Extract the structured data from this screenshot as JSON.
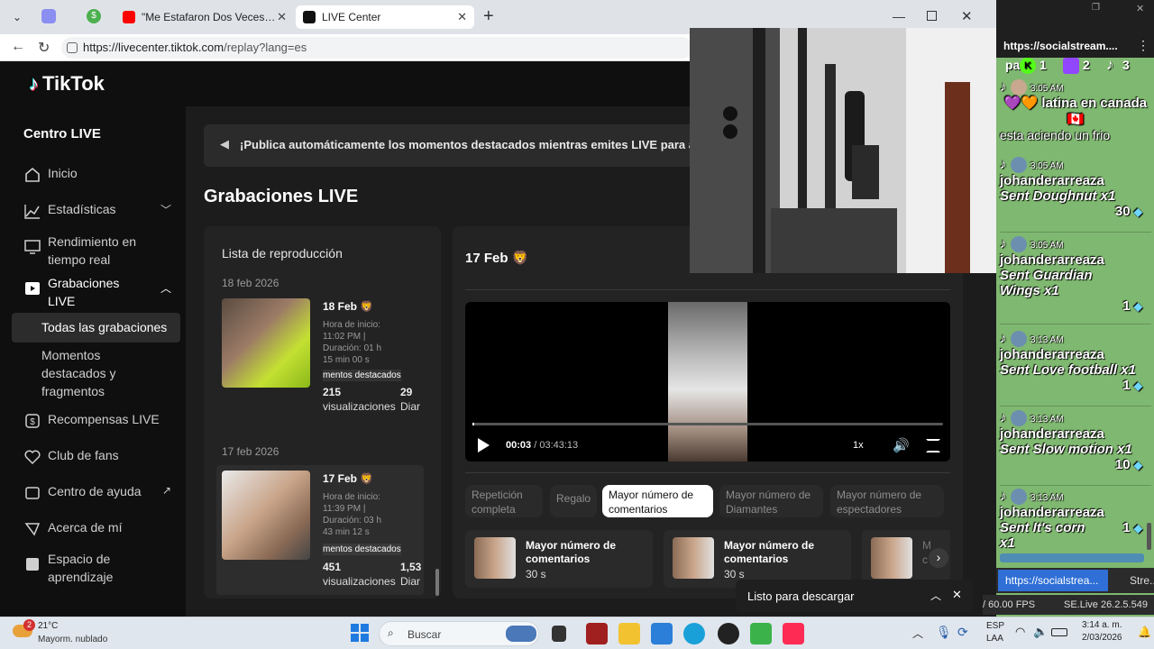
{
  "browser": {
    "tabs": [
      {
        "label": "\"Me Estafaron Dos Veces y hoy Te"
      },
      {
        "label": "LIVE Center"
      }
    ],
    "url_host": "https://livecenter.tiktok.com",
    "url_path": "/replay?lang=es"
  },
  "sidebar": {
    "logo": "TikTok",
    "title": "Centro LIVE",
    "items": [
      {
        "label": "Inicio"
      },
      {
        "label": "Estadísticas"
      },
      {
        "label": "Rendimiento en tiempo real"
      },
      {
        "label": "Grabaciones LIVE"
      },
      {
        "label": "Todas las grabaciones"
      },
      {
        "label": "Momentos destacados y fragmentos"
      },
      {
        "label": "Recompensas LIVE"
      },
      {
        "label": "Club de fans"
      },
      {
        "label": "Centro de ayuda"
      },
      {
        "label": "Acerca de mí"
      },
      {
        "label": "Espacio de aprendizaje"
      }
    ]
  },
  "main": {
    "banner": "¡Publica automáticamente los momentos destacados mientras emites LIVE para atr",
    "title": "Grabaciones LIVE",
    "playlist": {
      "title": "Lista de reproducción",
      "groups": [
        {
          "date": "18 feb 2026",
          "item": {
            "title": "18 Feb 🦁",
            "start_label": "Hora de inicio:",
            "start": "11:02 PM |",
            "duration_label": "Duración: 01 h",
            "duration": "15 min 00 s",
            "highlights": "mentos destacados",
            "views": "215",
            "views_label": "visualizaciones",
            "diamonds": "29",
            "diamonds_label": "Diar"
          }
        },
        {
          "date": "17 feb 2026",
          "item": {
            "title": "17 Feb 🦁",
            "start_label": "Hora de inicio:",
            "start": "11:39 PM |",
            "duration_label": "Duración: 03 h",
            "duration": "43 min 12 s",
            "highlights": "mentos destacados",
            "views": "451",
            "views_label": "visualizaciones",
            "diamonds": "1,53",
            "diamonds_label": "Diar"
          }
        }
      ]
    },
    "player": {
      "title": "17 Feb 🦁",
      "current_time": "00:03",
      "total_time": "03:43:13",
      "speed": "1x",
      "progress": 0.0002
    },
    "filters": [
      {
        "label": "Repetición completa"
      },
      {
        "label": "Regalo"
      },
      {
        "label": "Mayor número de comentarios"
      },
      {
        "label": "Mayor número de Diamantes"
      },
      {
        "label": "Mayor número de espectadores"
      }
    ],
    "highlights": [
      {
        "title": "Mayor número de comentarios",
        "duration": "30 s"
      },
      {
        "title": "Mayor número de comentarios",
        "duration": "30 s"
      },
      {
        "title": "M",
        "duration": "c"
      }
    ]
  },
  "toast": {
    "label": "Listo para descargar"
  },
  "chat": {
    "url": "https://socialstream....",
    "header_counts": [
      "1",
      "2",
      "3"
    ],
    "header_text": "pa",
    "messages": [
      {
        "time": "3:05 AM",
        "name": "💜🧡 latina en canada🇨🇦",
        "text": "esta aciendo un frio",
        "amount": ""
      },
      {
        "time": "3:05 AM",
        "name": "johanderarreaza",
        "text": "Sent Doughnut x1",
        "amount": "30"
      },
      {
        "time": "3:05 AM",
        "name": "johanderarreaza",
        "text": "Sent Guardian Wings x1",
        "amount": "1"
      },
      {
        "time": "3:13 AM",
        "name": "johanderarreaza",
        "text": "Sent Love football x1",
        "amount": "1"
      },
      {
        "time": "3:13 AM",
        "name": "johanderarreaza",
        "text": "Sent Slow motion x1",
        "amount": "10"
      },
      {
        "time": "3:13 AM",
        "name": "johanderarreaza",
        "text": "Sent It's corn x1",
        "amount": "1"
      }
    ],
    "bottom_tabs": [
      "https://socialstrea...",
      "Stre..."
    ],
    "fps": "/ 60.00 FPS",
    "version": "SE.Live 26.2.5.549"
  },
  "taskbar": {
    "weather_temp": "21°C",
    "weather_desc": "Mayorm. nublado",
    "weather_badge": "2",
    "search": "Buscar",
    "lang1": "ESP",
    "lang2": "LAA",
    "time": "3:14 a. m.",
    "date": "2/03/2026"
  },
  "colors": {
    "accent_red": "#fe2c55",
    "accent_cyan": "#25f4ee",
    "chat_bg": "#7fb870"
  }
}
